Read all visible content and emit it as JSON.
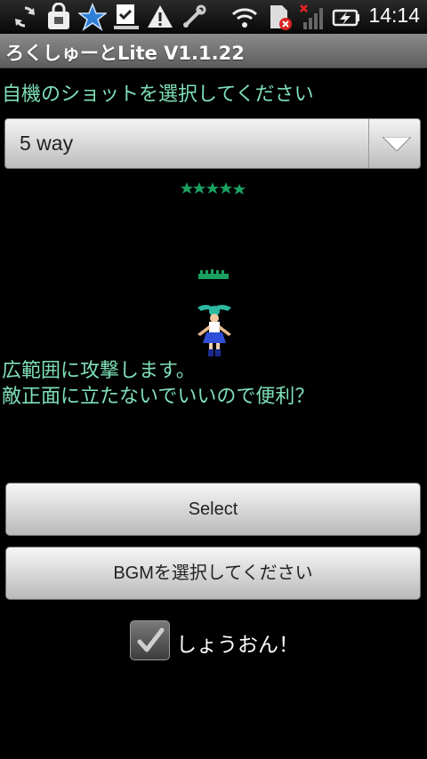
{
  "status_bar": {
    "icons": [
      "sync-icon",
      "shopping-bag-icon",
      "star-icon",
      "download-complete-icon",
      "warning-icon",
      "usb-debug-icon",
      "wifi-icon",
      "no-sim-icon",
      "no-signal-icon",
      "battery-charging-icon"
    ],
    "time": "14:14"
  },
  "app": {
    "title": "ろくしゅーとLite V1.1.22"
  },
  "main": {
    "prompt": "自機のショットを選択してください",
    "shot_spinner": {
      "selected": "5 way"
    },
    "description": [
      "広範囲に攻撃します。",
      "敵正面に立たないでいいので便利？"
    ],
    "select_button": "Select",
    "bgm_button": "BGMを選択してください",
    "sound_checkbox": {
      "label": "しょうおん！",
      "checked": true
    }
  },
  "colors": {
    "accent_text": "#7fe0b8",
    "background": "#000000",
    "sprite_green": "#1aa060"
  }
}
